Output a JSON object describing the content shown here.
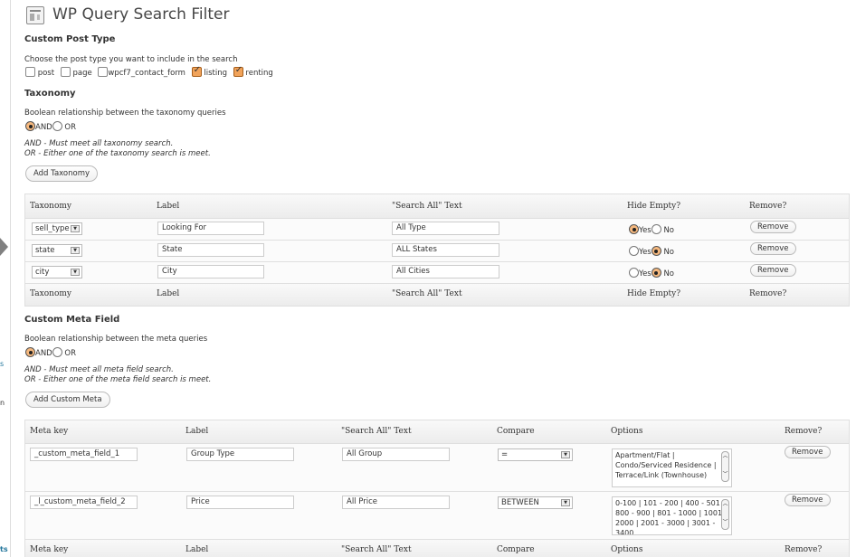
{
  "page": {
    "title": "WP Query Search Filter"
  },
  "admin_fragments": [
    "s",
    "n",
    "ts"
  ],
  "post_type": {
    "heading": "Custom Post Type",
    "description": "Choose the post type you want to include in the search",
    "options": [
      {
        "label": "post",
        "checked": false
      },
      {
        "label": "page",
        "checked": false
      },
      {
        "label": "wpcf7_contact_form",
        "checked": false
      },
      {
        "label": "listing",
        "checked": true
      },
      {
        "label": "renting",
        "checked": true
      }
    ]
  },
  "taxonomy": {
    "heading": "Taxonomy",
    "relation_label": "Boolean relationship between the taxonomy queries",
    "and_label": "AND",
    "or_label": "OR",
    "selected": "AND",
    "note_and": "AND - Must meet all taxonomy search.",
    "note_or": "OR - Either one of the taxonomy search is meet.",
    "add_button": "Add Taxonomy",
    "columns": [
      "Taxonomy",
      "Label",
      "\"Search All\" Text",
      "Hide Empty?",
      "Remove?"
    ],
    "yes_label": "Yes",
    "no_label": "No",
    "remove_label": "Remove",
    "rows": [
      {
        "taxonomy": "sell_type",
        "label": "Looking For",
        "search_all": "All Type",
        "hide_empty": "Yes"
      },
      {
        "taxonomy": "state",
        "label": "State",
        "search_all": "ALL States",
        "hide_empty": "No"
      },
      {
        "taxonomy": "city",
        "label": "City",
        "search_all": "All Cities",
        "hide_empty": "No"
      }
    ]
  },
  "meta": {
    "heading": "Custom Meta Field",
    "relation_label": "Boolean relationship between the meta queries",
    "and_label": "AND",
    "or_label": "OR",
    "selected": "AND",
    "note_and": "AND - Must meet all meta field search.",
    "note_or": "OR - Either one of the meta field search is meet.",
    "add_button": "Add Custom Meta",
    "columns": [
      "Meta key",
      "Label",
      "\"Search All\" Text",
      "Compare",
      "Options",
      "Remove?"
    ],
    "remove_label": "Remove",
    "rows": [
      {
        "key": "_custom_meta_field_1",
        "label": "Group Type",
        "search_all": "All Group",
        "compare": "=",
        "options": "Apartment/Flat | Condo/Serviced Residence | Terrace/Link (Townhouse)"
      },
      {
        "key": "_l_custom_meta_field_2",
        "label": "Price",
        "search_all": "All Price",
        "compare": "BETWEEN",
        "options": "0-100 | 101 - 200 | 400 - 501 | 800 - 900 | 801 - 1000 | 1001 - 2000 | 2001 - 3000 | 3001 - 3400"
      }
    ]
  }
}
